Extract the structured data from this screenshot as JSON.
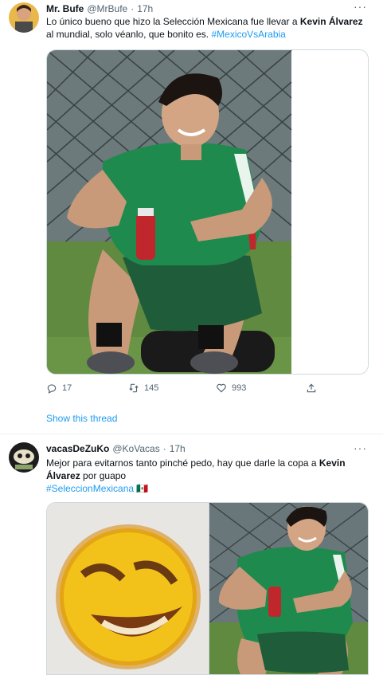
{
  "tweets": [
    {
      "name": "Mr. Bufe",
      "handle": "@MrBufe",
      "separator": "·",
      "time": "17h",
      "more": "···",
      "text_parts": {
        "pre": "Lo único bueno que hizo la Selección Mexicana fue llevar a ",
        "bold": "Kevin Álvarez",
        "post": " al mundial, solo véanlo, que bonito es. ",
        "hashtag": "#MexicoVsArabia"
      },
      "stats": {
        "replies": "17",
        "retweets": "145",
        "likes": "993"
      },
      "show_thread": "Show this thread"
    },
    {
      "name": "vacasDeZuKo",
      "handle": "@KoVacas",
      "separator": "·",
      "time": "17h",
      "more": "···",
      "text_parts": {
        "pre": "Mejor para evitarnos tanto pinché pedo, hay que darle la copa a ",
        "bold": "Kevin Álvarez",
        "post": " por guapo",
        "hashtag": "#SeleccionMexicana",
        "flag": "🇲🇽"
      }
    }
  ],
  "colors": {
    "link": "#1d9bf0",
    "secondary": "#536471",
    "jersey": "#1f8a4e",
    "shorts": "#1e5c3a"
  },
  "icons": [
    "more-icon",
    "reply-icon",
    "retweet-icon",
    "like-icon",
    "share-icon"
  ]
}
